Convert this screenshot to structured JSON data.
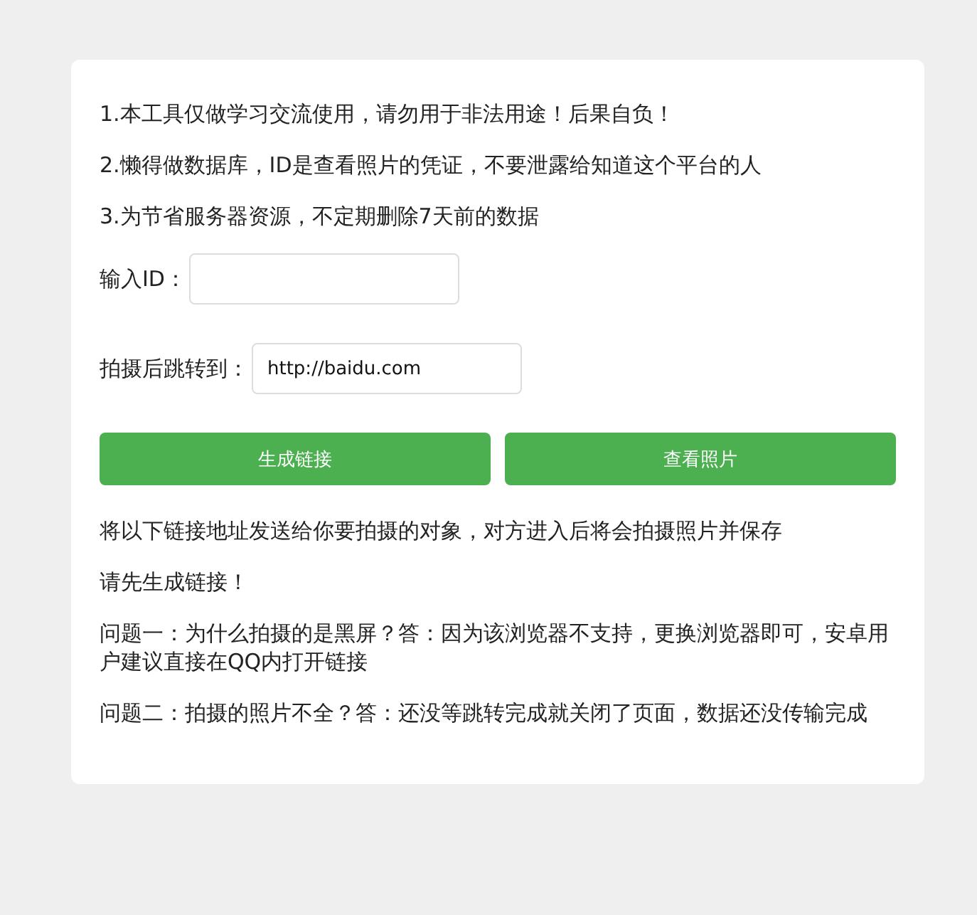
{
  "notices": [
    "1.本工具仅做学习交流使用，请勿用于非法用途！后果自负！",
    "2.懒得做数据库，ID是查看照片的凭证，不要泄露给知道这个平台的人",
    "3.为节省服务器资源，不定期删除7天前的数据"
  ],
  "fields": [
    {
      "label": "输入ID："
    },
    {
      "label": "拍摄后跳转到：",
      "value": "http://baidu.com"
    }
  ],
  "buttons": [
    "生成链接",
    "查看照片"
  ],
  "messages": [
    "将以下链接地址发送给你要拍摄的对象，对方进入后将会拍摄照片并保存",
    "请先生成链接！",
    "问题一：为什么拍摄的是黑屏？答：因为该浏览器不支持，更换浏览器即可，安卓用户建议直接在QQ内打开链接",
    "问题二：拍摄的照片不全？答：还没等跳转完成就关闭了页面，数据还没传输完成"
  ]
}
